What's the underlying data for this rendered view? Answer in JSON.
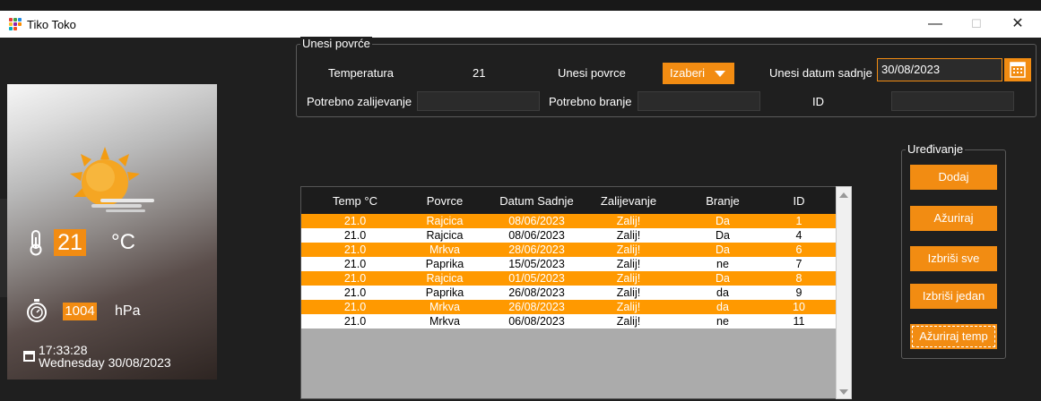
{
  "window": {
    "title": "Tiko Toko",
    "minimize": "—",
    "maximize": "☐",
    "close": "✕"
  },
  "weather": {
    "icon": "sun-cloud-icon",
    "temperature": "21",
    "temp_unit": "°C",
    "pressure": "1004",
    "pressure_unit": "hPa",
    "time": "17:33:28",
    "date": "Wednesday 30/08/2023"
  },
  "form": {
    "legend": "Unesi povrće",
    "temperature_label": "Temperatura",
    "temperature_value": "21",
    "vegetable_label": "Unesi povrce",
    "vegetable_select": "Izaberi",
    "date_label": "Unesi datum sadnje",
    "date_value": "30/08/2023",
    "watering_label": "Potrebno zalijevanje",
    "watering_value": "",
    "harvest_label": "Potrebno branje",
    "harvest_value": "",
    "id_label": "ID",
    "id_value": ""
  },
  "table": {
    "columns": [
      "Temp °C",
      "Povrce",
      "Datum Sadnje",
      "Zalijevanje",
      "Branje",
      "ID"
    ],
    "rows": [
      [
        "21.0",
        "Rajcica",
        "08/06/2023",
        "Zalij!",
        "Da",
        "1"
      ],
      [
        "21.0",
        "Rajcica",
        "08/06/2023",
        "Zalij!",
        "Da",
        "4"
      ],
      [
        "21.0",
        "Mrkva",
        "28/06/2023",
        "Zalij!",
        "Da",
        "6"
      ],
      [
        "21.0",
        "Paprika",
        "15/05/2023",
        "Zalij!",
        "ne",
        "7"
      ],
      [
        "21.0",
        "Rajcica",
        "01/05/2023",
        "Zalij!",
        "Da",
        "8"
      ],
      [
        "21.0",
        "Paprika",
        "26/08/2023",
        "Zalij!",
        "da",
        "9"
      ],
      [
        "21.0",
        "Mrkva",
        "26/08/2023",
        "Zalij!",
        "da",
        "10"
      ],
      [
        "21.0",
        "Mrkva",
        "06/08/2023",
        "Zalij!",
        "ne",
        "11"
      ]
    ]
  },
  "editing": {
    "legend": "Uređivanje",
    "add": "Dodaj",
    "update": "Ažuriraj",
    "delete_all": "Izbriši sve",
    "delete_one": "Izbriši jedan",
    "update_temp": "Ažuriraj temp"
  },
  "colors": {
    "accent": "#f28c12",
    "row_alt": "#ff9900"
  }
}
